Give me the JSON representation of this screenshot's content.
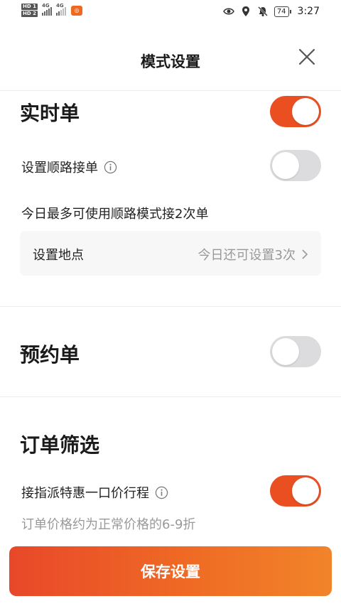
{
  "status_bar": {
    "sim1": "HD 1",
    "sim2": "HD 2",
    "network1": "4G",
    "network2": "4G",
    "battery": "74",
    "time": "3:27"
  },
  "header": {
    "title": "模式设置"
  },
  "realtime": {
    "title": "实时单",
    "enabled": true,
    "route_label": "设置顺路接单",
    "route_enabled": false,
    "route_limit_text": "今日最多可使用顺路模式接2次单",
    "location_label": "设置地点",
    "location_remaining": "今日还可设置3次"
  },
  "reservation": {
    "title": "预约单",
    "enabled": false
  },
  "filter": {
    "title": "订单筛选",
    "discount_label": "接指派特惠一口价行程",
    "discount_enabled": true,
    "discount_note": "订单价格约为正常价格的6-9折"
  },
  "footer": {
    "save_label": "保存设置"
  },
  "colors": {
    "accent": "#ea4f22",
    "toggle_off": "#dcdcdf"
  }
}
